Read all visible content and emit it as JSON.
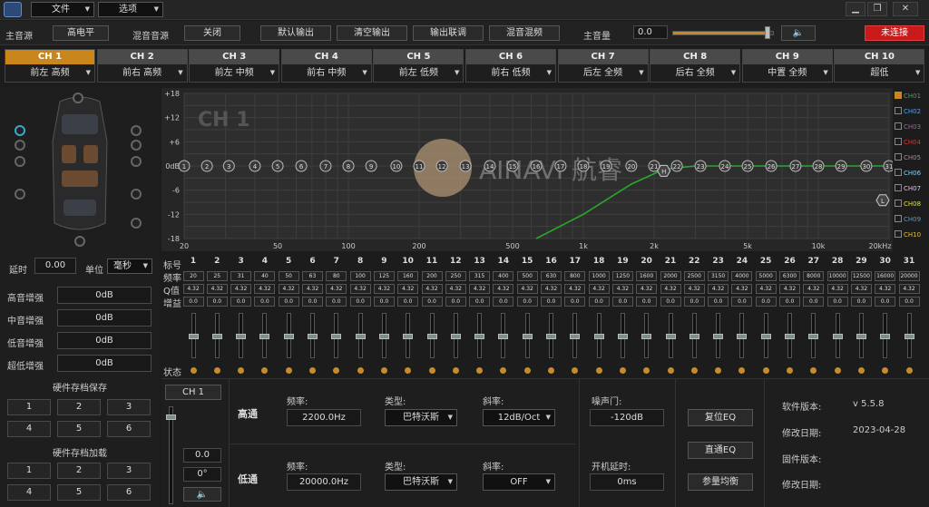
{
  "menu": {
    "file": "文件",
    "options": "选项"
  },
  "window_buttons": [
    "▁",
    "❐",
    "✕"
  ],
  "toprow": {
    "main_source_label": "主音源",
    "main_source_value": "高电平",
    "mix_source_label": "混音音源",
    "mix_source_value": "关闭",
    "default_output": "默认输出",
    "clear_output": "清空输出",
    "output_link": "输出联调",
    "mix_mix": "混音混频",
    "master_volume_label": "主音量",
    "master_volume_value": "0.0",
    "master_volume_level": 0.95,
    "connection": "未连接"
  },
  "channels": [
    {
      "name": "CH 1",
      "role": "前左 高频"
    },
    {
      "name": "CH 2",
      "role": "前右 高频"
    },
    {
      "name": "CH 3",
      "role": "前左 中频"
    },
    {
      "name": "CH 4",
      "role": "前右 中频"
    },
    {
      "name": "CH 5",
      "role": "前左 低频"
    },
    {
      "name": "CH 6",
      "role": "前右 低频"
    },
    {
      "name": "CH 7",
      "role": "后左 全频"
    },
    {
      "name": "CH 8",
      "role": "后右 全频"
    },
    {
      "name": "CH 9",
      "role": "中置 全频"
    },
    {
      "name": "CH 10",
      "role": "超低"
    }
  ],
  "left": {
    "delay_label": "延时",
    "delay_value": "0.00",
    "unit_label": "单位",
    "unit_value": "毫秒",
    "gains": [
      {
        "label": "高音增强",
        "value": "0dB"
      },
      {
        "label": "中音增强",
        "value": "0dB"
      },
      {
        "label": "低音增强",
        "value": "0dB"
      },
      {
        "label": "超低增强",
        "value": "0dB"
      }
    ],
    "save_title": "硬件存档保存",
    "load_title": "硬件存档加载",
    "slots": [
      "1",
      "2",
      "3",
      "4",
      "5",
      "6"
    ]
  },
  "chart_data": {
    "type": "line",
    "title": "CH 1",
    "y_ticks": [
      "+18",
      "+12",
      "+6",
      "0dB",
      "-6",
      "-12",
      "-18"
    ],
    "x_ticks": [
      "20",
      "50",
      "100",
      "200",
      "500",
      "1k",
      "2k",
      "5k",
      "10k",
      "20kHz"
    ],
    "ylim": [
      -18,
      18
    ],
    "xlim": [
      20,
      20000
    ],
    "x_scale": "log",
    "grid": true,
    "series": [
      {
        "values": [
          [
            630,
            -18
          ],
          [
            1000,
            -12
          ],
          [
            1600,
            -4.5
          ],
          [
            2200,
            -0.8
          ],
          [
            3000,
            0
          ],
          [
            20000,
            0
          ]
        ]
      }
    ],
    "points": [
      "1",
      "2",
      "3",
      "4",
      "5",
      "6",
      "7",
      "8",
      "9",
      "10",
      "11",
      "12",
      "13",
      "14",
      "15",
      "16",
      "17",
      "18",
      "19",
      "20",
      "21",
      "22",
      "23",
      "24",
      "25",
      "26",
      "27",
      "28",
      "29",
      "30",
      "31"
    ],
    "marker_h": "H",
    "marker_l": "L",
    "watermark": "AINAVI 航睿"
  },
  "legend": [
    {
      "name": "CH01",
      "color": "#3ab03a",
      "checked": true
    },
    {
      "name": "CH02",
      "color": "#4aa0ff"
    },
    {
      "name": "CH03",
      "color": "#c050c0"
    },
    {
      "name": "CH04",
      "color": "#e03030"
    },
    {
      "name": "CH05",
      "color": "#c08080"
    },
    {
      "name": "CH06",
      "color": "#80d0ff"
    },
    {
      "name": "CH07",
      "color": "#ffb0ff"
    },
    {
      "name": "CH08",
      "color": "#e0e040"
    },
    {
      "name": "CH09",
      "color": "#40a0e0"
    },
    {
      "name": "CH10",
      "color": "#e0c040"
    }
  ],
  "eq": {
    "row_labels": {
      "index": "标号",
      "freq": "频率",
      "q": "Q值",
      "gain": "增益",
      "state": "状态"
    },
    "bands": [
      {
        "n": "1",
        "f": "20"
      },
      {
        "n": "2",
        "f": "25"
      },
      {
        "n": "3",
        "f": "31"
      },
      {
        "n": "4",
        "f": "40"
      },
      {
        "n": "5",
        "f": "50"
      },
      {
        "n": "6",
        "f": "63"
      },
      {
        "n": "7",
        "f": "80"
      },
      {
        "n": "8",
        "f": "100"
      },
      {
        "n": "9",
        "f": "125"
      },
      {
        "n": "10",
        "f": "160"
      },
      {
        "n": "11",
        "f": "200"
      },
      {
        "n": "12",
        "f": "250"
      },
      {
        "n": "13",
        "f": "315"
      },
      {
        "n": "14",
        "f": "400"
      },
      {
        "n": "15",
        "f": "500"
      },
      {
        "n": "16",
        "f": "630"
      },
      {
        "n": "17",
        "f": "800"
      },
      {
        "n": "18",
        "f": "1000"
      },
      {
        "n": "19",
        "f": "1250"
      },
      {
        "n": "20",
        "f": "1600"
      },
      {
        "n": "21",
        "f": "2000"
      },
      {
        "n": "22",
        "f": "2500"
      },
      {
        "n": "23",
        "f": "3150"
      },
      {
        "n": "24",
        "f": "4000"
      },
      {
        "n": "25",
        "f": "5000"
      },
      {
        "n": "26",
        "f": "6300"
      },
      {
        "n": "27",
        "f": "8000"
      },
      {
        "n": "28",
        "f": "10000"
      },
      {
        "n": "29",
        "f": "12500"
      },
      {
        "n": "30",
        "f": "16000"
      },
      {
        "n": "31",
        "f": "20000"
      }
    ],
    "q": "4.32",
    "gain": "0.0"
  },
  "bottom": {
    "channel": "CH 1",
    "vol": "0.0",
    "phase": "0°",
    "hp_label": "高通",
    "lp_label": "低通",
    "freq_label": "频率:",
    "type_label": "类型:",
    "slope_label": "斜率:",
    "hp_freq": "2200.0Hz",
    "hp_type": "巴特沃斯",
    "hp_slope": "12dB/Oct",
    "lp_freq": "20000.0Hz",
    "lp_type": "巴特沃斯",
    "lp_slope": "OFF",
    "noise_gate_label": "噪声门:",
    "noise_gate": "-120dB",
    "power_delay_label": "开机延时:",
    "power_delay": "0ms",
    "reset_eq": "复位EQ",
    "bypass_eq": "直通EQ",
    "param_eq": "参量均衡",
    "sw_ver_label": "软件版本:",
    "sw_ver": "v 5.5.8",
    "mod_date_label": "修改日期:",
    "mod_date": "2023-04-28",
    "fw_ver_label": "固件版本:",
    "fw_mod_label": "修改日期:"
  }
}
